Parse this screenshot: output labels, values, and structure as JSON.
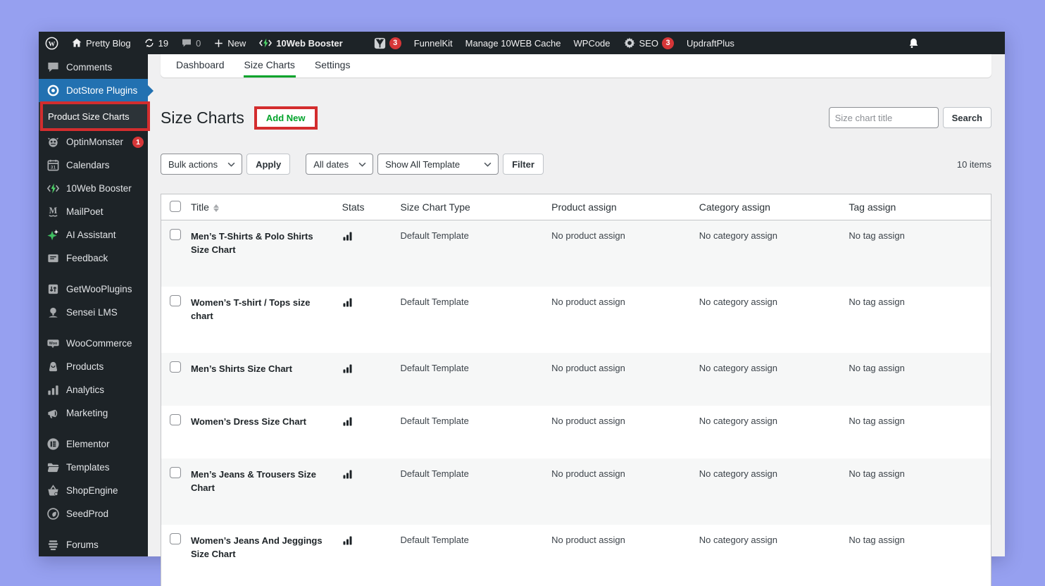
{
  "admin_bar": {
    "site_name": "Pretty Blog",
    "updates_count": "19",
    "comments_count": "0",
    "new_label": "New",
    "booster_label": "10Web Booster",
    "yoast_badge": "3",
    "links": [
      "FunnelKit",
      "Manage 10WEB Cache",
      "WPCode"
    ],
    "seo_label": "SEO",
    "seo_badge": "3",
    "updraft_label": "UpdraftPlus"
  },
  "sidebar": {
    "items": [
      {
        "label": "Comments",
        "icon": "comments-icon"
      },
      {
        "label": "DotStore Plugins",
        "icon": "dotstore-icon",
        "active": true
      },
      {
        "label": "Product Size Charts",
        "submenu": true,
        "annotated": true
      },
      {
        "label": "OptinMonster",
        "icon": "optinmonster-icon",
        "badge": "1"
      },
      {
        "label": "Calendars",
        "icon": "calendar-icon"
      },
      {
        "label": "10Web Booster",
        "icon": "booster-icon"
      },
      {
        "label": "MailPoet",
        "icon": "mailpoet-icon"
      },
      {
        "label": "AI Assistant",
        "icon": "ai-assistant-icon"
      },
      {
        "label": "Feedback",
        "icon": "feedback-icon",
        "gap_after": true
      },
      {
        "label": "GetWooPlugins",
        "icon": "getwooplugins-icon"
      },
      {
        "label": "Sensei LMS",
        "icon": "sensei-icon",
        "gap_after": true
      },
      {
        "label": "WooCommerce",
        "icon": "woocommerce-icon"
      },
      {
        "label": "Products",
        "icon": "products-icon"
      },
      {
        "label": "Analytics",
        "icon": "analytics-icon"
      },
      {
        "label": "Marketing",
        "icon": "marketing-icon",
        "gap_after": true
      },
      {
        "label": "Elementor",
        "icon": "elementor-icon"
      },
      {
        "label": "Templates",
        "icon": "templates-icon"
      },
      {
        "label": "ShopEngine",
        "icon": "shopengine-icon"
      },
      {
        "label": "SeedProd",
        "icon": "seedprod-icon",
        "gap_after": true
      },
      {
        "label": "Forums",
        "icon": "forums-icon"
      }
    ]
  },
  "tabs": [
    {
      "label": "Dashboard",
      "active": false
    },
    {
      "label": "Size Charts",
      "active": true
    },
    {
      "label": "Settings",
      "active": false
    }
  ],
  "page": {
    "title": "Size Charts",
    "add_new_label": "Add New",
    "search_placeholder": "Size chart title",
    "search_button_label": "Search"
  },
  "filters": {
    "bulk_actions": "Bulk actions",
    "apply_label": "Apply",
    "all_dates": "All dates",
    "template_filter": "Show All Template",
    "filter_label": "Filter",
    "items_count": "10 items"
  },
  "table": {
    "headers": [
      "Title",
      "Stats",
      "Size Chart Type",
      "Product assign",
      "Category assign",
      "Tag assign"
    ],
    "rows": [
      {
        "title": "Men’s T-Shirts & Polo Shirts Size Chart",
        "type": "Default Template",
        "product": "No product assign",
        "category": "No category assign",
        "tag": "No tag assign"
      },
      {
        "title": "Women’s T-shirt / Tops size chart",
        "type": "Default Template",
        "product": "No product assign",
        "category": "No category assign",
        "tag": "No tag assign"
      },
      {
        "title": "Men’s Shirts Size Chart",
        "type": "Default Template",
        "product": "No product assign",
        "category": "No category assign",
        "tag": "No tag assign"
      },
      {
        "title": "Women’s Dress Size Chart",
        "type": "Default Template",
        "product": "No product assign",
        "category": "No category assign",
        "tag": "No tag assign"
      },
      {
        "title": "Men’s Jeans & Trousers Size Chart",
        "type": "Default Template",
        "product": "No product assign",
        "category": "No category assign",
        "tag": "No tag assign"
      },
      {
        "title": "Women’s Jeans And Jeggings Size Chart",
        "type": "Default Template",
        "product": "No product assign",
        "category": "No category assign",
        "tag": "No tag assign"
      }
    ]
  },
  "colors": {
    "accent_green": "#00a32a",
    "annotation_red": "#d32d2e",
    "highlight_blue": "#2271b1",
    "badge_red": "#d63638",
    "adminbar_dark": "#1d2327",
    "background_purple": "#96a0f0"
  }
}
